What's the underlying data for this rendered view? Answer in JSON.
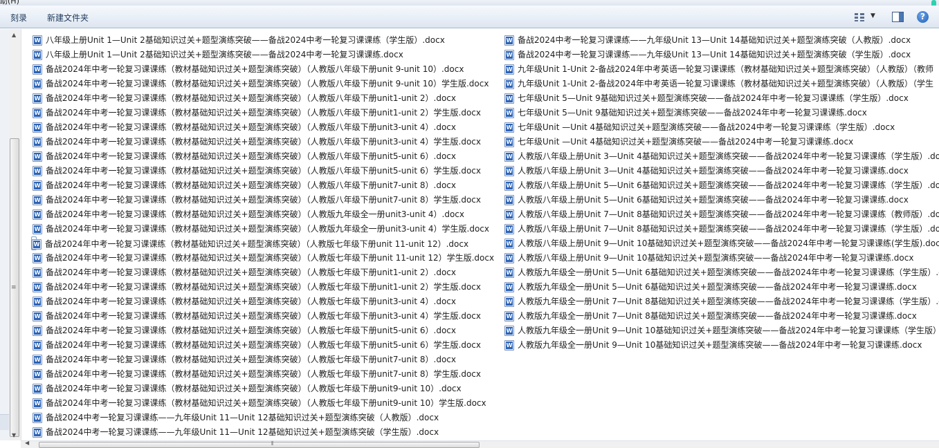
{
  "window": {
    "menu_partial": "助(H)"
  },
  "toolbar": {
    "burn_label": "刻录",
    "new_folder_label": "新建文件夹",
    "icons": [
      "view-options-icon",
      "chevron-down-icon",
      "preview-pane-icon",
      "help-icon"
    ],
    "help_glyph": "?"
  },
  "colors": {
    "toolbar_text": "#1e395b",
    "selection_border": "#7da2ce",
    "word_icon": "#2b63b7"
  },
  "files_col1": [
    "八年级上册Unit 1—Unit 2基础知识过关+题型演练突破——备战2024中考一轮复习课课练（学生版）.docx",
    "八年级上册Unit 1—Unit 2基础知识过关+题型演练突破——备战2024中考一轮复习课课练.docx",
    "备战2024年中考一轮复习课课练（教材基础知识过关+题型演练突破）（人教版八年级下册unit 9-unit 10）.docx",
    "备战2024年中考一轮复习课课练（教材基础知识过关+题型演练突破）（人教版八年级下册unit 9-unit 10）学生版.docx",
    "备战2024年中考一轮复习课课练（教材基础知识过关+题型演练突破）（人教版八年级下册unit1-unit 2）.docx",
    "备战2024年中考一轮复习课课练（教材基础知识过关+题型演练突破）（人教版八年级下册unit1-unit 2）学生版.docx",
    "备战2024年中考一轮复习课课练（教材基础知识过关+题型演练突破）（人教版八年级下册unit3-unit 4）.docx",
    "备战2024年中考一轮复习课课练（教材基础知识过关+题型演练突破）（人教版八年级下册unit3-unit 4）学生版.docx",
    "备战2024年中考一轮复习课课练（教材基础知识过关+题型演练突破）（人教版八年级下册unit5-unit 6）.docx",
    "备战2024年中考一轮复习课课练（教材基础知识过关+题型演练突破）（人教版八年级下册unit5-unit 6）学生版.docx",
    "备战2024年中考一轮复习课课练（教材基础知识过关+题型演练突破）（人教版八年级下册unit7-unit 8）.docx",
    "备战2024年中考一轮复习课课练（教材基础知识过关+题型演练突破）（人教版八年级下册unit7-unit 8）学生版.docx",
    "备战2024年中考一轮复习课课练（教材基础知识过关+题型演练突破）（人教版九年级全一册unit3-unit 4）.docx",
    "备战2024年中考一轮复习课课练（教材基础知识过关+题型演练突破）（人教版九年级全一册unit3-unit 4）学生版.docx",
    "备战2024年中考一轮复习课课练（教材基础知识过关+题型演练突破）（人教版七年级下册unit 11-unit 12）.docx",
    "备战2024年中考一轮复习课课练（教材基础知识过关+题型演练突破）（人教版七年级下册unit 11-unit 12）学生版.docx",
    "备战2024年中考一轮复习课课练（教材基础知识过关+题型演练突破）（人教版七年级下册unit1-unit 2）.docx",
    "备战2024年中考一轮复习课课练（教材基础知识过关+题型演练突破）（人教版七年级下册unit1-unit 2）学生版.docx",
    "备战2024年中考一轮复习课课练（教材基础知识过关+题型演练突破）（人教版七年级下册unit3-unit 4）.docx",
    "备战2024年中考一轮复习课课练（教材基础知识过关+题型演练突破）（人教版七年级下册unit3-unit 4）学生版.docx",
    "备战2024年中考一轮复习课课练（教材基础知识过关+题型演练突破）（人教版七年级下册unit5-unit 6）.docx",
    "备战2024年中考一轮复习课课练（教材基础知识过关+题型演练突破）（人教版七年级下册unit5-unit 6）学生版.docx",
    "备战2024年中考一轮复习课课练（教材基础知识过关+题型演练突破）（人教版七年级下册unit7-unit 8）.docx",
    "备战2024年中考一轮复习课课练（教材基础知识过关+题型演练突破）（人教版七年级下册unit7-unit 8）学生版.docx",
    "备战2024年中考一轮复习课课练（教材基础知识过关+题型演练突破）（人教版七年级下册unit9-unit 10）.docx",
    "备战2024年中考一轮复习课课练（教材基础知识过关+题型演练突破）（人教版七年级下册unit9-unit 10）学生版.docx",
    "备战2024中考一轮复习课课练——九年级Unit 11—Unit 12基础知识过关+题型演练突破（人教版）.docx",
    "备战2024中考一轮复习课课练——九年级Unit 11—Unit 12基础知识过关+题型演练突破（学生版）.docx"
  ],
  "files_col2": [
    "备战2024中考一轮复习课课练——九年级Unit 13—Unit 14基础知识过关+题型演练突破（人教版）.docx",
    "备战2024中考一轮复习课课练——九年级Unit 13—Unit 14基础知识过关+题型演练突破（学生版）.docx",
    "九年级Unit 1-Unit 2-备战2024年中考英语一轮复习课课练（教材基础知识过关+题型演练突破）（人教版）（教师",
    "九年级Unit 1-Unit 2-备战2024年中考英语一轮复习课课练（教材基础知识过关+题型演练突破）（人教版）（学生",
    "七年级Unit 5—Unit 9基础知识过关+题型演练突破——备战2024年中考一轮复习课课练（学生版）.docx",
    "七年级Unit 5—Unit 9基础知识过关+题型演练突破——备战2024年中考一轮复习课课练.docx",
    "七年级Unit —Unit 4基础知识过关+题型演练突破——备战2024中考一轮复习课课练（学生版）.docx",
    "七年级Unit —Unit 4基础知识过关+题型演练突破——备战2024中考一轮复习课课练.docx",
    "人教版八年级上册Unit 3—Unit 4基础知识过关+题型演练突破——备战2024年中考一轮复习课课练（学生版）.docx",
    "人教版八年级上册Unit 3—Unit 4基础知识过关+题型演练突破——备战2024年中考一轮复习课课练.docx",
    "人教版八年级上册Unit 5—Unit 6基础知识过关+题型演练突破——备战2024年中考一轮复习课课练（学生版）.docx",
    "人教版八年级上册Unit 5—Unit 6基础知识过关+题型演练突破——备战2024年中考一轮复习课课练.docx",
    "人教版八年级上册Unit 7—Unit 8基础知识过关+题型演练突破——备战2024年中考一轮复习课课练（教师版）.docx",
    "人教版八年级上册Unit 7—Unit 8基础知识过关+题型演练突破——备战2024年中考一轮复习课课练（学生版）.docx",
    "人教版八年级上册Unit 9—Unit 10基础知识过关+题型演练突破——备战2024年中考一轮复习课课练(学生版).docx",
    "人教版八年级上册Unit 9—Unit 10基础知识过关+题型演练突破——备战2024年中考一轮复习课课练.docx",
    "人教版九年级全一册Unit 5—Unit 6基础知识过关+题型演练突破——备战2024年中考一轮复习课课练（学生版）.do",
    "人教版九年级全一册Unit 5—Unit 6基础知识过关+题型演练突破——备战2024年中考一轮复习课课练.docx",
    "人教版九年级全一册Unit 7—Unit 8基础知识过关+题型演练突破——备战2024年中考一轮复习课课练（学生版）.do",
    "人教版九年级全一册Unit 7—Unit 8基础知识过关+题型演练突破——备战2024年中考一轮复习课课练.docx",
    "人教版九年级全一册Unit 9—Unit 10基础知识过关+题型演练突破——备战2024年中考一轮复习课课练（学生版）.d",
    "人教版九年级全一册Unit 9—Unit 10基础知识过关+题型演练突破——备战2024年中考一轮复习课课练.docx"
  ],
  "selected": {
    "column": 1,
    "index": 14
  }
}
